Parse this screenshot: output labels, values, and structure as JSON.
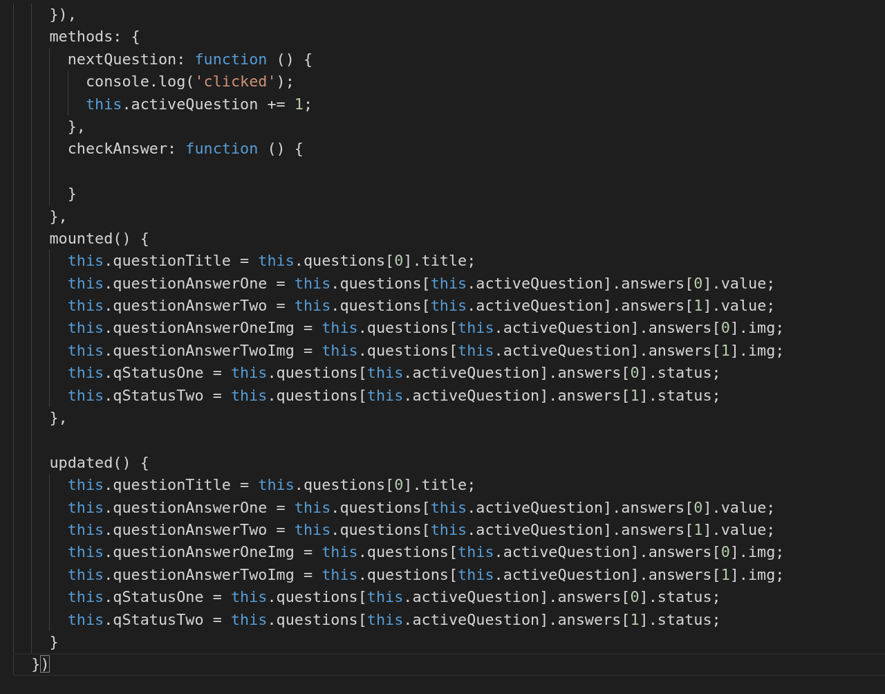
{
  "editor": {
    "lines": [
      {
        "current": false,
        "tokens": [
          {
            "kind": "plain",
            "text": "    }),"
          }
        ]
      },
      {
        "current": false,
        "tokens": [
          {
            "kind": "plain",
            "text": "    methods: {"
          }
        ]
      },
      {
        "current": false,
        "tokens": [
          {
            "kind": "plain",
            "text": "      nextQuestion: "
          },
          {
            "kind": "keyword",
            "text": "function"
          },
          {
            "kind": "plain",
            "text": " () {"
          }
        ]
      },
      {
        "current": false,
        "tokens": [
          {
            "kind": "plain",
            "text": "        console.log("
          },
          {
            "kind": "string",
            "text": "'clicked'"
          },
          {
            "kind": "plain",
            "text": ");"
          }
        ]
      },
      {
        "current": false,
        "tokens": [
          {
            "kind": "keyword",
            "text": "        this"
          },
          {
            "kind": "plain",
            "text": ".activeQuestion += "
          },
          {
            "kind": "number",
            "text": "1"
          },
          {
            "kind": "plain",
            "text": ";"
          }
        ]
      },
      {
        "current": false,
        "tokens": [
          {
            "kind": "plain",
            "text": "      },"
          }
        ]
      },
      {
        "current": false,
        "tokens": [
          {
            "kind": "plain",
            "text": "      checkAnswer: "
          },
          {
            "kind": "keyword",
            "text": "function"
          },
          {
            "kind": "plain",
            "text": " () {"
          }
        ]
      },
      {
        "current": false
      },
      {
        "current": false,
        "tokens": [
          {
            "kind": "plain",
            "text": "      }"
          }
        ]
      },
      {
        "current": false,
        "tokens": [
          {
            "kind": "plain",
            "text": "    },"
          }
        ]
      },
      {
        "current": false,
        "tokens": [
          {
            "kind": "plain",
            "text": "    mounted() {"
          }
        ]
      },
      {
        "current": false,
        "tokens": [
          {
            "kind": "keyword",
            "text": "      this"
          },
          {
            "kind": "plain",
            "text": ".questionTitle = "
          },
          {
            "kind": "keyword",
            "text": "this"
          },
          {
            "kind": "plain",
            "text": ".questions["
          },
          {
            "kind": "number",
            "text": "0"
          },
          {
            "kind": "plain",
            "text": "].title;"
          }
        ]
      },
      {
        "current": false,
        "tokens": [
          {
            "kind": "keyword",
            "text": "      this"
          },
          {
            "kind": "plain",
            "text": ".questionAnswerOne = "
          },
          {
            "kind": "keyword",
            "text": "this"
          },
          {
            "kind": "plain",
            "text": ".questions["
          },
          {
            "kind": "keyword",
            "text": "this"
          },
          {
            "kind": "plain",
            "text": ".activeQuestion].answers["
          },
          {
            "kind": "number",
            "text": "0"
          },
          {
            "kind": "plain",
            "text": "].value;"
          }
        ]
      },
      {
        "current": false,
        "tokens": [
          {
            "kind": "keyword",
            "text": "      this"
          },
          {
            "kind": "plain",
            "text": ".questionAnswerTwo = "
          },
          {
            "kind": "keyword",
            "text": "this"
          },
          {
            "kind": "plain",
            "text": ".questions["
          },
          {
            "kind": "keyword",
            "text": "this"
          },
          {
            "kind": "plain",
            "text": ".activeQuestion].answers["
          },
          {
            "kind": "number",
            "text": "1"
          },
          {
            "kind": "plain",
            "text": "].value;"
          }
        ]
      },
      {
        "current": false,
        "tokens": [
          {
            "kind": "keyword",
            "text": "      this"
          },
          {
            "kind": "plain",
            "text": ".questionAnswerOneImg = "
          },
          {
            "kind": "keyword",
            "text": "this"
          },
          {
            "kind": "plain",
            "text": ".questions["
          },
          {
            "kind": "keyword",
            "text": "this"
          },
          {
            "kind": "plain",
            "text": ".activeQuestion].answers["
          },
          {
            "kind": "number",
            "text": "0"
          },
          {
            "kind": "plain",
            "text": "].img;"
          }
        ]
      },
      {
        "current": false,
        "tokens": [
          {
            "kind": "keyword",
            "text": "      this"
          },
          {
            "kind": "plain",
            "text": ".questionAnswerTwoImg = "
          },
          {
            "kind": "keyword",
            "text": "this"
          },
          {
            "kind": "plain",
            "text": ".questions["
          },
          {
            "kind": "keyword",
            "text": "this"
          },
          {
            "kind": "plain",
            "text": ".activeQuestion].answers["
          },
          {
            "kind": "number",
            "text": "1"
          },
          {
            "kind": "plain",
            "text": "].img;"
          }
        ]
      },
      {
        "current": false,
        "tokens": [
          {
            "kind": "keyword",
            "text": "      this"
          },
          {
            "kind": "plain",
            "text": ".qStatusOne = "
          },
          {
            "kind": "keyword",
            "text": "this"
          },
          {
            "kind": "plain",
            "text": ".questions["
          },
          {
            "kind": "keyword",
            "text": "this"
          },
          {
            "kind": "plain",
            "text": ".activeQuestion].answers["
          },
          {
            "kind": "number",
            "text": "0"
          },
          {
            "kind": "plain",
            "text": "].status;"
          }
        ]
      },
      {
        "current": false,
        "tokens": [
          {
            "kind": "keyword",
            "text": "      this"
          },
          {
            "kind": "plain",
            "text": ".qStatusTwo = "
          },
          {
            "kind": "keyword",
            "text": "this"
          },
          {
            "kind": "plain",
            "text": ".questions["
          },
          {
            "kind": "keyword",
            "text": "this"
          },
          {
            "kind": "plain",
            "text": ".activeQuestion].answers["
          },
          {
            "kind": "number",
            "text": "1"
          },
          {
            "kind": "plain",
            "text": "].status;"
          }
        ]
      },
      {
        "current": false,
        "tokens": [
          {
            "kind": "plain",
            "text": "    },"
          }
        ]
      },
      {
        "current": false
      },
      {
        "current": false,
        "tokens": [
          {
            "kind": "plain",
            "text": "    updated() {"
          }
        ]
      },
      {
        "current": false,
        "tokens": [
          {
            "kind": "keyword",
            "text": "      this"
          },
          {
            "kind": "plain",
            "text": ".questionTitle = "
          },
          {
            "kind": "keyword",
            "text": "this"
          },
          {
            "kind": "plain",
            "text": ".questions["
          },
          {
            "kind": "number",
            "text": "0"
          },
          {
            "kind": "plain",
            "text": "].title;"
          }
        ]
      },
      {
        "current": false,
        "tokens": [
          {
            "kind": "keyword",
            "text": "      this"
          },
          {
            "kind": "plain",
            "text": ".questionAnswerOne = "
          },
          {
            "kind": "keyword",
            "text": "this"
          },
          {
            "kind": "plain",
            "text": ".questions["
          },
          {
            "kind": "keyword",
            "text": "this"
          },
          {
            "kind": "plain",
            "text": ".activeQuestion].answers["
          },
          {
            "kind": "number",
            "text": "0"
          },
          {
            "kind": "plain",
            "text": "].value;"
          }
        ]
      },
      {
        "current": false,
        "tokens": [
          {
            "kind": "keyword",
            "text": "      this"
          },
          {
            "kind": "plain",
            "text": ".questionAnswerTwo = "
          },
          {
            "kind": "keyword",
            "text": "this"
          },
          {
            "kind": "plain",
            "text": ".questions["
          },
          {
            "kind": "keyword",
            "text": "this"
          },
          {
            "kind": "plain",
            "text": ".activeQuestion].answers["
          },
          {
            "kind": "number",
            "text": "1"
          },
          {
            "kind": "plain",
            "text": "].value;"
          }
        ]
      },
      {
        "current": false,
        "tokens": [
          {
            "kind": "keyword",
            "text": "      this"
          },
          {
            "kind": "plain",
            "text": ".questionAnswerOneImg = "
          },
          {
            "kind": "keyword",
            "text": "this"
          },
          {
            "kind": "plain",
            "text": ".questions["
          },
          {
            "kind": "keyword",
            "text": "this"
          },
          {
            "kind": "plain",
            "text": ".activeQuestion].answers["
          },
          {
            "kind": "number",
            "text": "0"
          },
          {
            "kind": "plain",
            "text": "].img;"
          }
        ]
      },
      {
        "current": false,
        "tokens": [
          {
            "kind": "keyword",
            "text": "      this"
          },
          {
            "kind": "plain",
            "text": ".questionAnswerTwoImg = "
          },
          {
            "kind": "keyword",
            "text": "this"
          },
          {
            "kind": "plain",
            "text": ".questions["
          },
          {
            "kind": "keyword",
            "text": "this"
          },
          {
            "kind": "plain",
            "text": ".activeQuestion].answers["
          },
          {
            "kind": "number",
            "text": "1"
          },
          {
            "kind": "plain",
            "text": "].img;"
          }
        ]
      },
      {
        "current": false,
        "tokens": [
          {
            "kind": "keyword",
            "text": "      this"
          },
          {
            "kind": "plain",
            "text": ".qStatusOne = "
          },
          {
            "kind": "keyword",
            "text": "this"
          },
          {
            "kind": "plain",
            "text": ".questions["
          },
          {
            "kind": "keyword",
            "text": "this"
          },
          {
            "kind": "plain",
            "text": ".activeQuestion].answers["
          },
          {
            "kind": "number",
            "text": "0"
          },
          {
            "kind": "plain",
            "text": "].status;"
          }
        ]
      },
      {
        "current": false,
        "tokens": [
          {
            "kind": "keyword",
            "text": "      this"
          },
          {
            "kind": "plain",
            "text": ".qStatusTwo = "
          },
          {
            "kind": "keyword",
            "text": "this"
          },
          {
            "kind": "plain",
            "text": ".questions["
          },
          {
            "kind": "keyword",
            "text": "this"
          },
          {
            "kind": "plain",
            "text": ".activeQuestion].answers["
          },
          {
            "kind": "number",
            "text": "1"
          },
          {
            "kind": "plain",
            "text": "].status;"
          }
        ]
      },
      {
        "current": false,
        "tokens": [
          {
            "kind": "plain",
            "text": "    }"
          }
        ]
      },
      {
        "current": true,
        "tokens": [
          {
            "kind": "plain",
            "text": "  }"
          },
          {
            "kind": "bracket-match",
            "text": ")"
          }
        ]
      }
    ]
  }
}
